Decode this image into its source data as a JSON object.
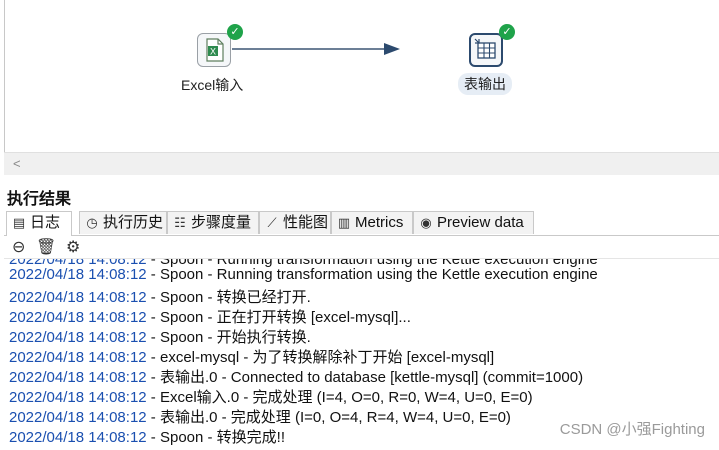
{
  "canvas": {
    "steps": [
      {
        "label": "Excel输入",
        "icon": "excel-input-icon",
        "status": "success"
      },
      {
        "label": "表输出",
        "icon": "table-output-icon",
        "status": "success"
      }
    ]
  },
  "results": {
    "title": "执行结果",
    "tabs": [
      {
        "label": "日志",
        "icon": "log-icon"
      },
      {
        "label": "执行历史",
        "icon": "history-icon"
      },
      {
        "label": "步骤度量",
        "icon": "step-metrics-icon"
      },
      {
        "label": "性能图",
        "icon": "performance-chart-icon"
      },
      {
        "label": "Metrics",
        "icon": "metrics-icon"
      },
      {
        "label": "Preview data",
        "icon": "preview-eye-icon"
      }
    ],
    "toolbar": [
      "stop-log-icon",
      "clear-log-icon",
      "settings-gear-icon"
    ],
    "log": [
      {
        "time": "2022/04/18 14:08:12",
        "text": " - Spoon - Running transformation using the Kettle execution engine"
      },
      {
        "time": "2022/04/18 14:08:12",
        "text": " - Spoon - 转换已经打开."
      },
      {
        "time": "2022/04/18 14:08:12",
        "text": " - Spoon - 正在打开转换 [excel-mysql]..."
      },
      {
        "time": "2022/04/18 14:08:12",
        "text": " - Spoon - 开始执行转换."
      },
      {
        "time": "2022/04/18 14:08:12",
        "text": " - excel-mysql - 为了转换解除补丁开始  [excel-mysql]"
      },
      {
        "time": "2022/04/18 14:08:12",
        "text": " - 表输出.0 - Connected to database [kettle-mysql] (commit=1000)"
      },
      {
        "time": "2022/04/18 14:08:12",
        "text": " - Excel输入.0 - 完成处理 (I=4, O=0, R=0, W=4, U=0, E=0)"
      },
      {
        "time": "2022/04/18 14:08:12",
        "text": " - 表输出.0 - 完成处理 (I=0, O=4, R=4, W=4, U=0, E=0)"
      },
      {
        "time": "2022/04/18 14:08:12",
        "text": " - Spoon - 转换完成!!"
      }
    ]
  },
  "watermark": "CSDN @小强Fighting",
  "colors": {
    "timestamp": "#1a4fb0",
    "success": "#1fa34a",
    "hop": "#2c4a6e"
  }
}
